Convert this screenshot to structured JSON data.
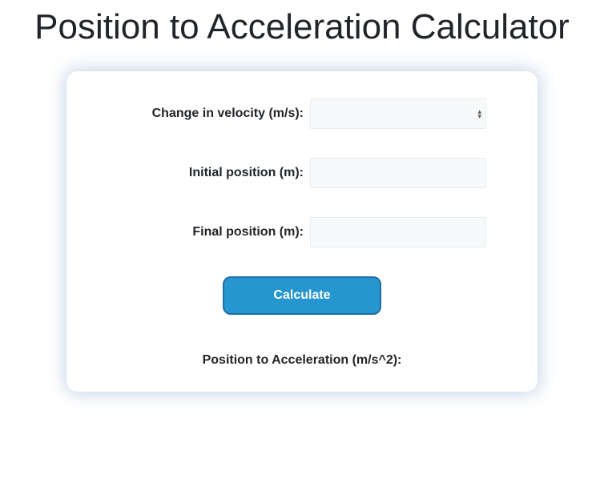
{
  "title": "Position to Acceleration Calculator",
  "form": {
    "field1": {
      "label": "Change in velocity (m/s):",
      "value": ""
    },
    "field2": {
      "label": "Initial position (m):",
      "value": ""
    },
    "field3": {
      "label": "Final position (m):",
      "value": ""
    },
    "button_label": "Calculate"
  },
  "result": {
    "label": "Position to Acceleration (m/s^2):",
    "value": ""
  }
}
